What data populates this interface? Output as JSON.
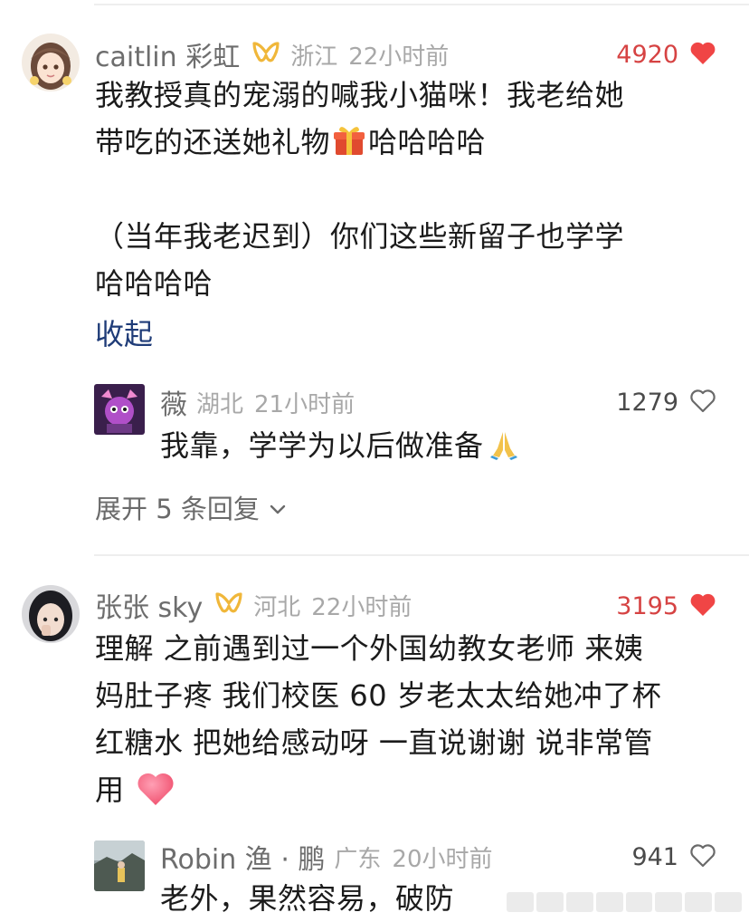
{
  "comments": [
    {
      "username": "caitlin 彩虹",
      "location": "浙江",
      "time": "22小时前",
      "likes": "4920",
      "liked": true,
      "text_lines": [
        "我教授真的宠溺的喊我小猫咪！我老给她",
        "带吃的还送她礼物",
        "哈哈哈哈",
        "（当年我老迟到）你们这些新留子也学学",
        "哈哈哈哈"
      ],
      "collapse_label": "收起",
      "reply": {
        "username": "薇",
        "location": "湖北",
        "time": "21小时前",
        "likes": "1279",
        "liked": false,
        "text": "我靠，学学为以后做准备"
      },
      "expand_label": "展开 5 条回复"
    },
    {
      "username": "张张 sky",
      "location": "河北",
      "time": "22小时前",
      "likes": "3195",
      "liked": true,
      "text_lines": [
        "理解 之前遇到过一个外国幼教女老师 来姨",
        "妈肚子疼 我们校医 60 岁老太太给她冲了杯",
        "红糖水 把她给感动呀 一直说谢谢 说非常管",
        "用"
      ],
      "reply": {
        "username": "Robin 渔 · 鹏",
        "location": "广东",
        "time": "20小时前",
        "likes": "941",
        "liked": false,
        "text": "老外，果然容易，破防"
      }
    }
  ],
  "colors": {
    "liked_red": "#f04545",
    "badge_gold": "#f0b73a",
    "link_blue": "#1f3c78"
  },
  "icons": {
    "heart_filled": "heart-icon",
    "heart_outline": "heart-outline-icon",
    "gift": "gift-emoji-icon",
    "pray": "pray-emoji-icon",
    "chevron": "chevron-down-icon",
    "badge": "vip-badge-icon"
  }
}
